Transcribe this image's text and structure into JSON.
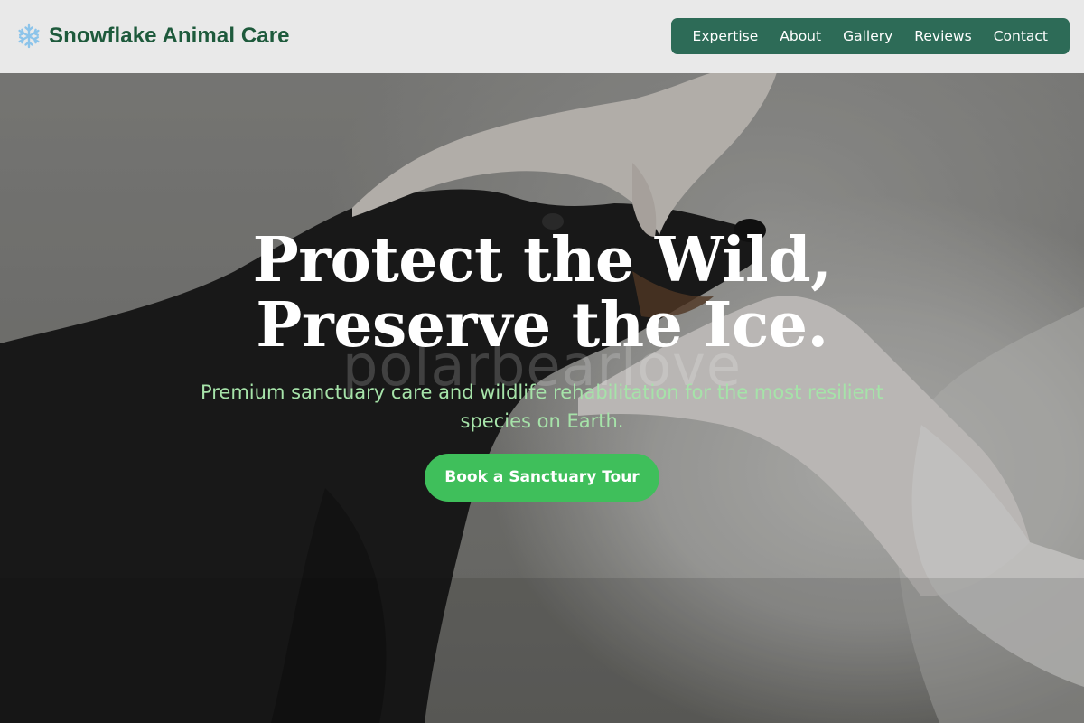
{
  "header": {
    "brand_icon": "snowflake-icon",
    "brand_name": "Snowflake Animal Care",
    "brand_color": "#1e5a3c"
  },
  "nav": {
    "background_color": "#2d6b57",
    "items": [
      {
        "label": "Expertise"
      },
      {
        "label": "About"
      },
      {
        "label": "Gallery"
      },
      {
        "label": "Reviews"
      },
      {
        "label": "Contact"
      }
    ]
  },
  "hero": {
    "title": "Protect the Wild, Preserve the Ice.",
    "watermark": "polarbearlove",
    "subtitle": "Premium sanctuary care and wildlife rehabilitation for the most resilient species on Earth.",
    "subtitle_color": "#a6e3a9",
    "cta_label": "Book a Sanctuary Tour",
    "cta_color": "#3fbf5b"
  }
}
